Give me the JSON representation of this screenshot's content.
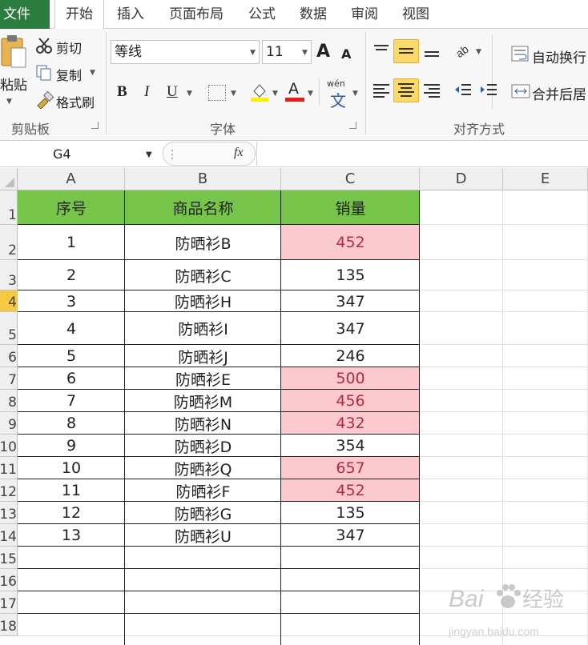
{
  "menu": {
    "file": "文件",
    "tabs": [
      "开始",
      "插入",
      "页面布局",
      "公式",
      "数据",
      "审阅",
      "视图"
    ]
  },
  "clipboard": {
    "paste": "粘贴",
    "cut": "剪切",
    "copy": "复制",
    "format_painter": "格式刷",
    "group": "剪贴板"
  },
  "font": {
    "name": "等线",
    "size": "11",
    "bold": "B",
    "italic": "I",
    "underline": "U",
    "font_color_glyph": "A",
    "grow": "A",
    "shrink": "A",
    "phonetic": "wén",
    "group": "字体"
  },
  "align": {
    "wrap": "自动换行",
    "merge": "合并后居",
    "group": "对齐方式"
  },
  "formula": {
    "name_box": "G4",
    "fx": "fx"
  },
  "columns": [
    "A",
    "B",
    "C",
    "D",
    "E"
  ],
  "row_numbers": [
    "1",
    "2",
    "3",
    "4",
    "5",
    "6",
    "7",
    "8",
    "9",
    "10",
    "11",
    "12",
    "13",
    "14",
    "15",
    "16",
    "17",
    "18"
  ],
  "table": {
    "headers": [
      "序号",
      "商品名称",
      "销量"
    ],
    "rows": [
      {
        "n": "1",
        "name": "防晒衫B",
        "qty": "452",
        "hl": true
      },
      {
        "n": "2",
        "name": "防晒衫C",
        "qty": "135",
        "hl": false
      },
      {
        "n": "3",
        "name": "防晒衫H",
        "qty": "347",
        "hl": false
      },
      {
        "n": "4",
        "name": "防晒衫I",
        "qty": "347",
        "hl": false
      },
      {
        "n": "5",
        "name": "防晒衫J",
        "qty": "246",
        "hl": false
      },
      {
        "n": "6",
        "name": "防晒衫E",
        "qty": "500",
        "hl": true
      },
      {
        "n": "7",
        "name": "防晒衫M",
        "qty": "456",
        "hl": true
      },
      {
        "n": "8",
        "name": "防晒衫N",
        "qty": "432",
        "hl": true
      },
      {
        "n": "9",
        "name": "防晒衫D",
        "qty": "354",
        "hl": false
      },
      {
        "n": "10",
        "name": "防晒衫Q",
        "qty": "657",
        "hl": true
      },
      {
        "n": "11",
        "name": "防晒衫F",
        "qty": "452",
        "hl": true
      },
      {
        "n": "12",
        "name": "防晒衫G",
        "qty": "135",
        "hl": false
      },
      {
        "n": "13",
        "name": "防晒衫U",
        "qty": "347",
        "hl": false
      }
    ]
  },
  "colors": {
    "header_fill": "#77c44a",
    "highlight_fill": "#fbc9ce",
    "highlight_text": "#b42c3b",
    "file_tab": "#2a7d3e",
    "selected_row_header": "#f5c944"
  },
  "watermark": {
    "brand": "Bai",
    "brand2": "经验",
    "url": "jingyan.baidu.com"
  }
}
